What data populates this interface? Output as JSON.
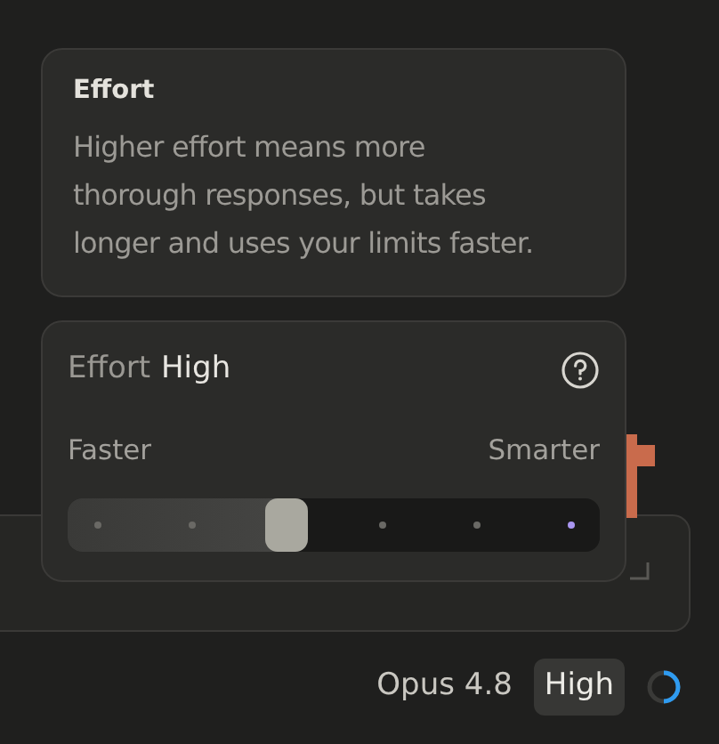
{
  "tooltip": {
    "title": "Effort",
    "body": "Higher effort means more thorough responses, but takes longer and uses your limits faster."
  },
  "effort_panel": {
    "label": "Effort",
    "value": "High",
    "min_label": "Faster",
    "max_label": "Smarter",
    "slider": {
      "level": 0.4
    }
  },
  "footer": {
    "model": "Opus 4.8",
    "effort": "High"
  }
}
